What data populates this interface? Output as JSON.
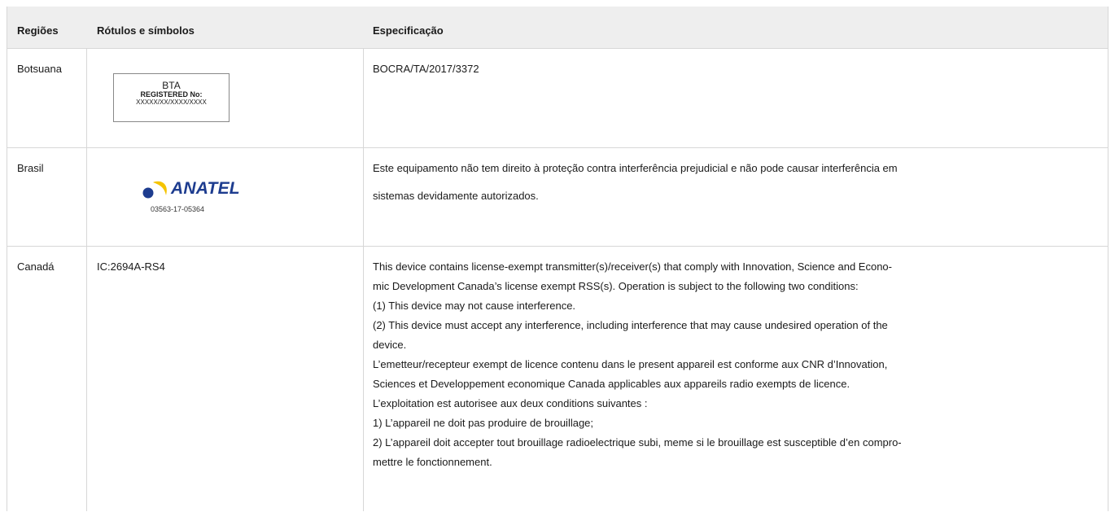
{
  "headers": {
    "regions": "Regiões",
    "labels": "Rótulos e símbolos",
    "spec": "Especificação"
  },
  "rows": [
    {
      "region": "Botsuana",
      "label": {
        "type": "bta-box",
        "title": "BTA",
        "registered": "REGISTERED No:",
        "number": "XXXXX/XX/XXXX/XXXX"
      },
      "spec": [
        "BOCRA/TA/2017/3372"
      ]
    },
    {
      "region": "Brasil",
      "label": {
        "type": "anatel-logo",
        "logo_text": "ANATEL",
        "number": "03563-17-05364",
        "colors": {
          "yellow": "#f5c400",
          "blue": "#1d3c8f"
        }
      },
      "spec": [
        "Este equipamento não tem direito à proteção contra interferência prejudicial e não pode causar interferência em",
        "sistemas devidamente autorizados."
      ]
    },
    {
      "region": "Canadá",
      "label": {
        "type": "text",
        "text": "IC:2694A-RS4"
      },
      "spec": [
        "This device contains license-exempt transmitter(s)/receiver(s) that comply with Innovation, Science and Econo-",
        "mic Development Canada’s license exempt RSS(s). Operation is subject to the following two conditions:",
        "(1) This device may not cause interference.",
        "(2) This device must accept any interference, including interference that may cause undesired operation of the",
        "device.",
        "L’emetteur/recepteur exempt de licence contenu dans le present appareil est conforme aux CNR d’Innovation,",
        "Sciences et Developpement economique Canada applicables aux appareils radio exempts de licence.",
        "L’exploitation est autorisee aux deux conditions suivantes :",
        "1) L’appareil ne doit pas produire de brouillage;",
        "2) L’appareil doit accepter tout brouillage radioelectrique subi, meme si le brouillage est susceptible d’en compro-",
        "mettre le fonctionnement."
      ]
    }
  ]
}
